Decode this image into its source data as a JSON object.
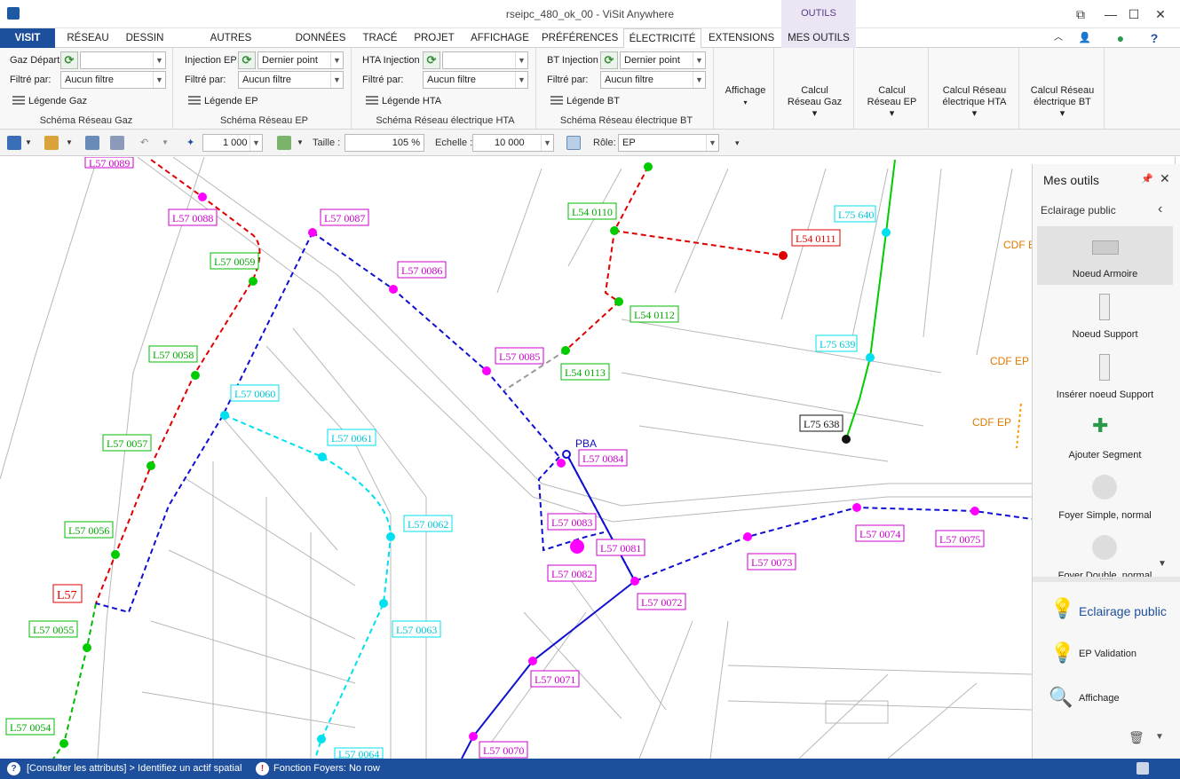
{
  "window": {
    "title": "rseipc_480_ok_00 - ViSit Anywhere",
    "contextual_tab_header": "OUTILS"
  },
  "tabs": [
    "VISIT",
    "RÉSEAU",
    "DESSIN",
    "AUTRES GÉOMÉTRIES",
    "DONNÉES",
    "TRACÉ",
    "PROJET",
    "AFFICHAGE",
    "PRÉFÉRENCES",
    "ÉLECTRICITÉ",
    "EXTENSIONS",
    "MES OUTILS"
  ],
  "ribbon": {
    "gaz": {
      "start_label": "Gaz Départ",
      "filter_label": "Filtré par:",
      "filter_value": "Aucun filtre",
      "legend": "Légende Gaz",
      "title": "Schéma Réseau Gaz"
    },
    "ep": {
      "start_label": "Injection EP",
      "start_value": "Dernier point",
      "filter_label": "Filtré par:",
      "filter_value": "Aucun filtre",
      "legend": "Légende EP",
      "title": "Schéma Réseau EP"
    },
    "hta": {
      "start_label": "HTA Injection",
      "filter_label": "Filtré par:",
      "filter_value": "Aucun filtre",
      "legend": "Légende HTA",
      "title": "Schéma Réseau électrique HTA"
    },
    "bt": {
      "start_label": "BT Injection",
      "start_value": "Dernier point",
      "filter_label": "Filtré par:",
      "filter_value": "Aucun filtre",
      "legend": "Légende BT",
      "title": "Schéma Réseau électrique BT"
    },
    "buttons": [
      {
        "line1": "Affichage",
        "line2": ""
      },
      {
        "line1": "Calcul",
        "line2": "Réseau Gaz"
      },
      {
        "line1": "Calcul",
        "line2": "Réseau EP"
      },
      {
        "line1": "Calcul Réseau",
        "line2": "électrique HTA"
      },
      {
        "line1": "Calcul Réseau",
        "line2": "électrique BT"
      }
    ]
  },
  "toolbar": {
    "scale_value": "1 000",
    "taille_label": "Taille :",
    "taille_value": "105 %",
    "echelle_label": "Echelle :",
    "echelle_value": "10 000",
    "role_label": "Rôle:",
    "role_value": "EP"
  },
  "panel": {
    "title": "Mes outils",
    "subtitle": "Eclairage public",
    "items": [
      "Noeud Armoire",
      "Noeud Support",
      "Insérer noeud Support",
      "Ajouter Segment",
      "Foyer Simple, normal",
      "Foyer Double, normal"
    ],
    "bottom": [
      "Eclairage public",
      "EP Validation",
      "Affichage"
    ]
  },
  "status": {
    "left": "[Consulter les attributs] > Identifiez un actif spatial",
    "right": "Fonction Foyers: No row"
  },
  "map_labels": {
    "magenta": [
      "L57 0088",
      "L57 0087",
      "L57 0086",
      "L57 0085",
      "L57 0084",
      "L57 0083",
      "L57 0081",
      "L57 0082",
      "L57 0072",
      "L57 0073",
      "L57 0074",
      "L57 0075",
      "L57 0071",
      "L57 0070",
      "L57 0089"
    ],
    "green": [
      "L57 0059",
      "L57 0058",
      "L57 0057",
      "L57 0056",
      "L57 0055",
      "L57 0054",
      "L54 0110",
      "L54 0112",
      "L54 0113"
    ],
    "cyan": [
      "L57 0060",
      "L57 0061",
      "L57 0062",
      "L57 0063",
      "L57 0064",
      "L75 640",
      "L75 639"
    ],
    "red": [
      "L54 0111",
      "L57"
    ],
    "black": [
      "L75 638"
    ],
    "orange": [
      "CDF EP",
      "CDF EP",
      "CDF E"
    ],
    "blue_text": "PBA"
  },
  "colors": {
    "magenta": "#ff00ff",
    "green": "#00cc00",
    "cyan": "#00e5ee",
    "red": "#e00000",
    "blue": "#1010d0",
    "accent": "#1e4f9c"
  }
}
